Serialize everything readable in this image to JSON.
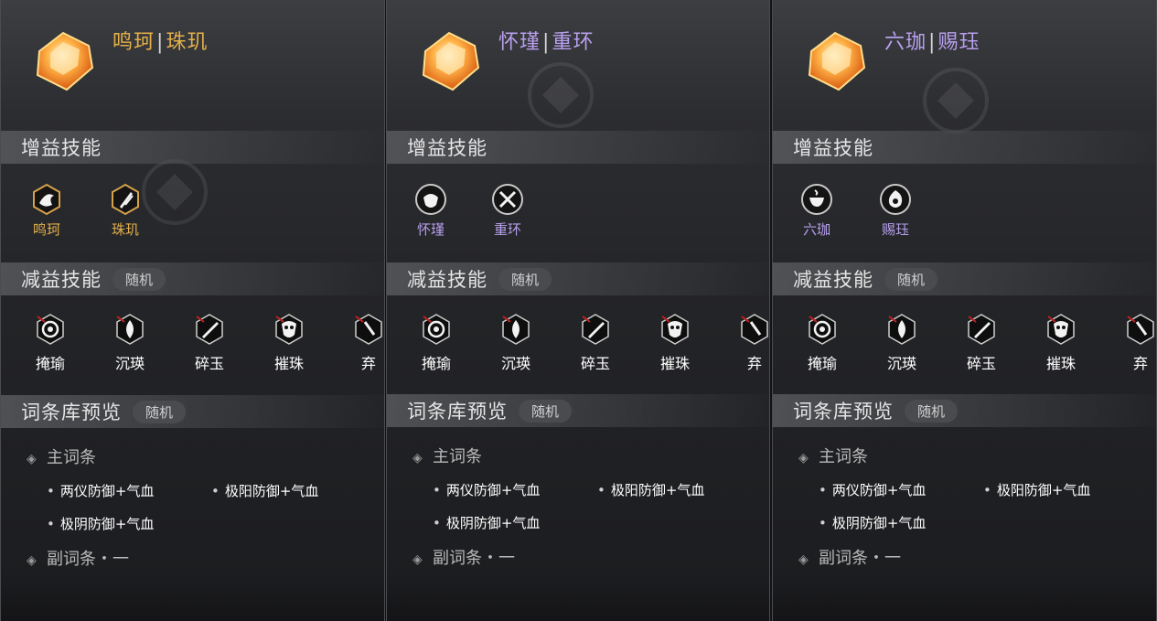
{
  "colors": {
    "gold": "#e4b04a",
    "purple": "#b9a0ee",
    "bar_text": "#e6e6e6"
  },
  "panels": [
    {
      "accent": "#e4b04a",
      "title_a": "鸣珂",
      "title_sep": "|",
      "title_b": "珠玑",
      "buff_title": "增益技能",
      "buffs": [
        {
          "label": "鸣珂",
          "icon": "flame-shield-icon"
        },
        {
          "label": "珠玑",
          "icon": "blade-hex-icon"
        }
      ],
      "debuff_title": "减益技能",
      "debuff_tag": "随机",
      "debuffs": [
        {
          "label": "掩瑜",
          "icon": "eye-hex-icon"
        },
        {
          "label": "沉瑛",
          "icon": "drop-hex-icon"
        },
        {
          "label": "碎玉",
          "icon": "sword-hex-icon"
        },
        {
          "label": "摧珠",
          "icon": "mask-hex-icon"
        },
        {
          "label": "弃",
          "icon": "partial-hex-icon"
        }
      ],
      "pool_title": "词条库预览",
      "pool_tag": "随机",
      "main_affix": "主词条",
      "affixes": [
        "两仪防御+气血",
        "极阳防御+气血",
        "极阴防御+气血"
      ],
      "sub_affix": "副词条・一"
    },
    {
      "accent": "#b9a0ee",
      "title_a": "怀瑾",
      "title_sep": "|",
      "title_b": "重环",
      "buff_title": "增益技能",
      "buffs": [
        {
          "label": "怀瑾",
          "icon": "acorn-icon"
        },
        {
          "label": "重环",
          "icon": "crossed-swords-icon"
        }
      ],
      "debuff_title": "减益技能",
      "debuff_tag": "随机",
      "debuffs": [
        {
          "label": "掩瑜",
          "icon": "eye-hex-icon"
        },
        {
          "label": "沉瑛",
          "icon": "drop-hex-icon"
        },
        {
          "label": "碎玉",
          "icon": "sword-hex-icon"
        },
        {
          "label": "摧珠",
          "icon": "mask-hex-icon"
        },
        {
          "label": "弃",
          "icon": "partial-hex-icon"
        }
      ],
      "pool_title": "词条库预览",
      "pool_tag": "随机",
      "main_affix": "主词条",
      "affixes": [
        "两仪防御+气血",
        "极阳防御+气血",
        "极阴防御+气血"
      ],
      "sub_affix": "副词条・一"
    },
    {
      "accent": "#b9a0ee",
      "title_a": "六珈",
      "title_sep": "|",
      "title_b": "赐珏",
      "buff_title": "增益技能",
      "buffs": [
        {
          "label": "六珈",
          "icon": "cup-icon"
        },
        {
          "label": "赐珏",
          "icon": "swirl-flame-icon"
        }
      ],
      "debuff_title": "减益技能",
      "debuff_tag": "随机",
      "debuffs": [
        {
          "label": "掩瑜",
          "icon": "eye-hex-icon"
        },
        {
          "label": "沉瑛",
          "icon": "drop-hex-icon"
        },
        {
          "label": "碎玉",
          "icon": "sword-hex-icon"
        },
        {
          "label": "摧珠",
          "icon": "mask-hex-icon"
        },
        {
          "label": "弃",
          "icon": "partial-hex-icon"
        }
      ],
      "pool_title": "词条库预览",
      "pool_tag": "随机",
      "main_affix": "主词条",
      "affixes": [
        "两仪防御+气血",
        "极阳防御+气血",
        "极阴防御+气血"
      ],
      "sub_affix": "副词条・一"
    }
  ]
}
